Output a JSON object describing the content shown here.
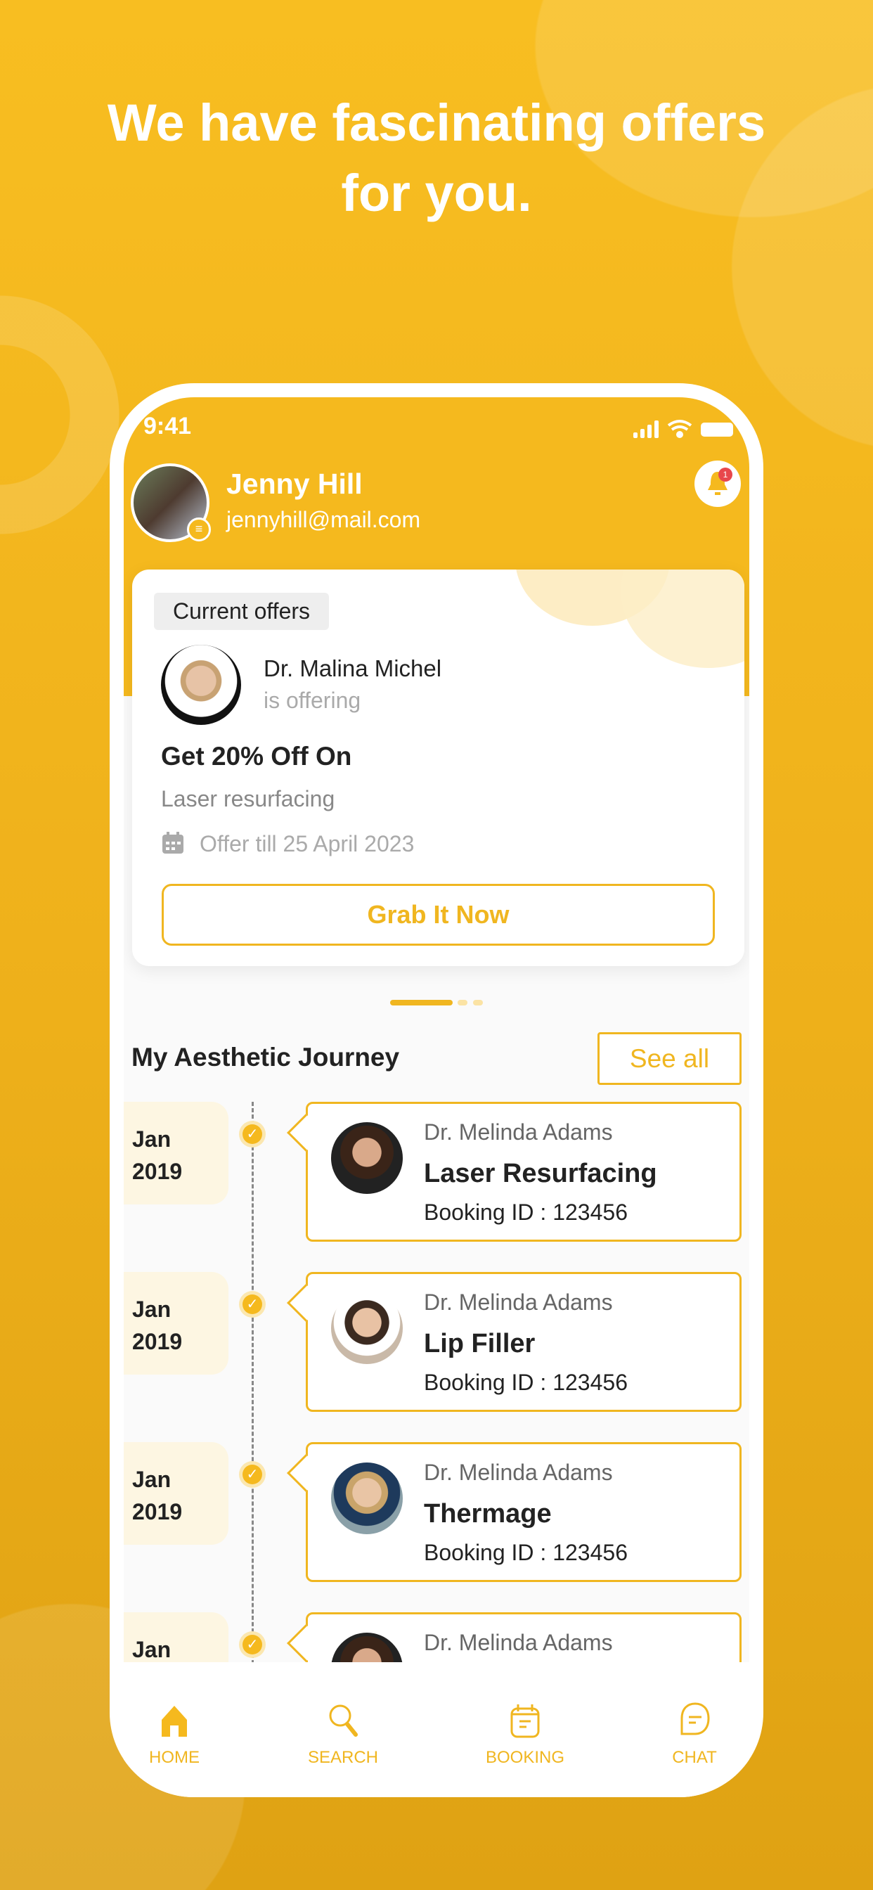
{
  "headline": {
    "line1": "We have fascinating offers",
    "line2": "for you."
  },
  "status_bar": {
    "time": "9:41"
  },
  "profile": {
    "name": "Jenny Hill",
    "email": "jennyhill@mail.com",
    "notification_count": "1"
  },
  "offer": {
    "tag": "Current offers",
    "doctor": "Dr. Malina Michel",
    "subtitle": "is offering",
    "title": "Get 20% Off On",
    "treatment": "Laser resurfacing",
    "validity": "Offer till 25 April 2023",
    "cta": "Grab It Now",
    "page_index": 1,
    "page_count": 3
  },
  "journey": {
    "title": "My Aesthetic Journey",
    "see_all": "See all",
    "items": [
      {
        "month": "Jan",
        "year": "2019",
        "doctor": "Dr. Melinda Adams",
        "procedure": "Laser Resurfacing",
        "booking": "Booking ID : 123456"
      },
      {
        "month": "Jan",
        "year": "2019",
        "doctor": "Dr. Melinda Adams",
        "procedure": "Lip Filler",
        "booking": "Booking ID : 123456"
      },
      {
        "month": "Jan",
        "year": "2019",
        "doctor": "Dr. Melinda Adams",
        "procedure": "Thermage",
        "booking": "Booking ID : 123456"
      },
      {
        "month": "Jan",
        "year": "",
        "doctor": "Dr. Melinda Adams",
        "procedure": "",
        "booking": ""
      }
    ]
  },
  "nav": [
    {
      "label": "HOME",
      "icon": "home-icon",
      "active": true
    },
    {
      "label": "SEARCH",
      "icon": "search-icon"
    },
    {
      "label": "BOOKING",
      "icon": "calendar-icon"
    },
    {
      "label": "CHAT",
      "icon": "chat-icon"
    }
  ],
  "colors": {
    "accent": "#f0b620",
    "background": "#f5b91e",
    "badge": "#e8474c"
  }
}
